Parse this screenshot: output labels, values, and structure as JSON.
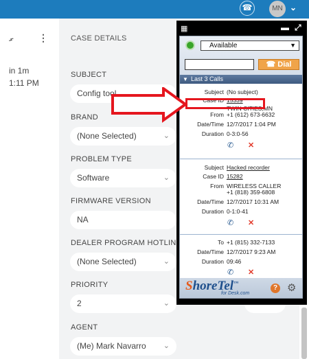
{
  "topbar": {
    "avatar_initials": "MN"
  },
  "activity": {
    "line1": "in 1m",
    "line2": "1:11 PM"
  },
  "case": {
    "header": "CASE DETAILS",
    "fields": [
      {
        "label": "SUBJECT",
        "value": "Config tool"
      },
      {
        "label": "BRAND",
        "value": "(None Selected)"
      },
      {
        "label": "PROBLEM TYPE",
        "value": "Software"
      },
      {
        "label": "FIRMWARE VERSION",
        "value": "NA"
      },
      {
        "label": "DEALER PROGRAM HOTLINE",
        "value": "(None Selected)"
      },
      {
        "label": "PRIORITY",
        "value": "2"
      },
      {
        "label": "AGENT",
        "value": "(Me) Mark Navarro"
      }
    ]
  },
  "widget": {
    "status": "Available",
    "dial_label": "Dial",
    "calls_header": "Last 3 Calls",
    "calls": [
      {
        "subject_key": "Subject",
        "subject": "(No subject)",
        "caseid_key": "Case ID",
        "caseid": "15339",
        "from_key": "From",
        "from1": "TWIN CITIES,MN",
        "from2": "+1 (612) 673-6632",
        "datetime_key": "Date/Time",
        "datetime": "12/7/2017 1:04 PM",
        "duration_key": "Duration",
        "duration": "0-3:0-56"
      },
      {
        "subject_key": "Subject",
        "subject": "Hacked recorder",
        "caseid_key": "Case ID",
        "caseid": "15282",
        "from_key": "From",
        "from1": "WIRELESS CALLER",
        "from2": "+1 (818) 359-6808",
        "datetime_key": "Date/Time",
        "datetime": "12/7/2017 10:31 AM",
        "duration_key": "Duration",
        "duration": "0-1:0-41"
      },
      {
        "to_key": "To",
        "to": "+1 (815) 332-7133",
        "datetime_key": "Date/Time",
        "datetime": "12/7/2017 9:23 AM",
        "duration_key": "Duration",
        "duration": "09:46"
      }
    ],
    "logo_main_a": "S",
    "logo_main_b": "horeTel",
    "logo_tm": "™",
    "logo_sub": "for Desk.com"
  }
}
